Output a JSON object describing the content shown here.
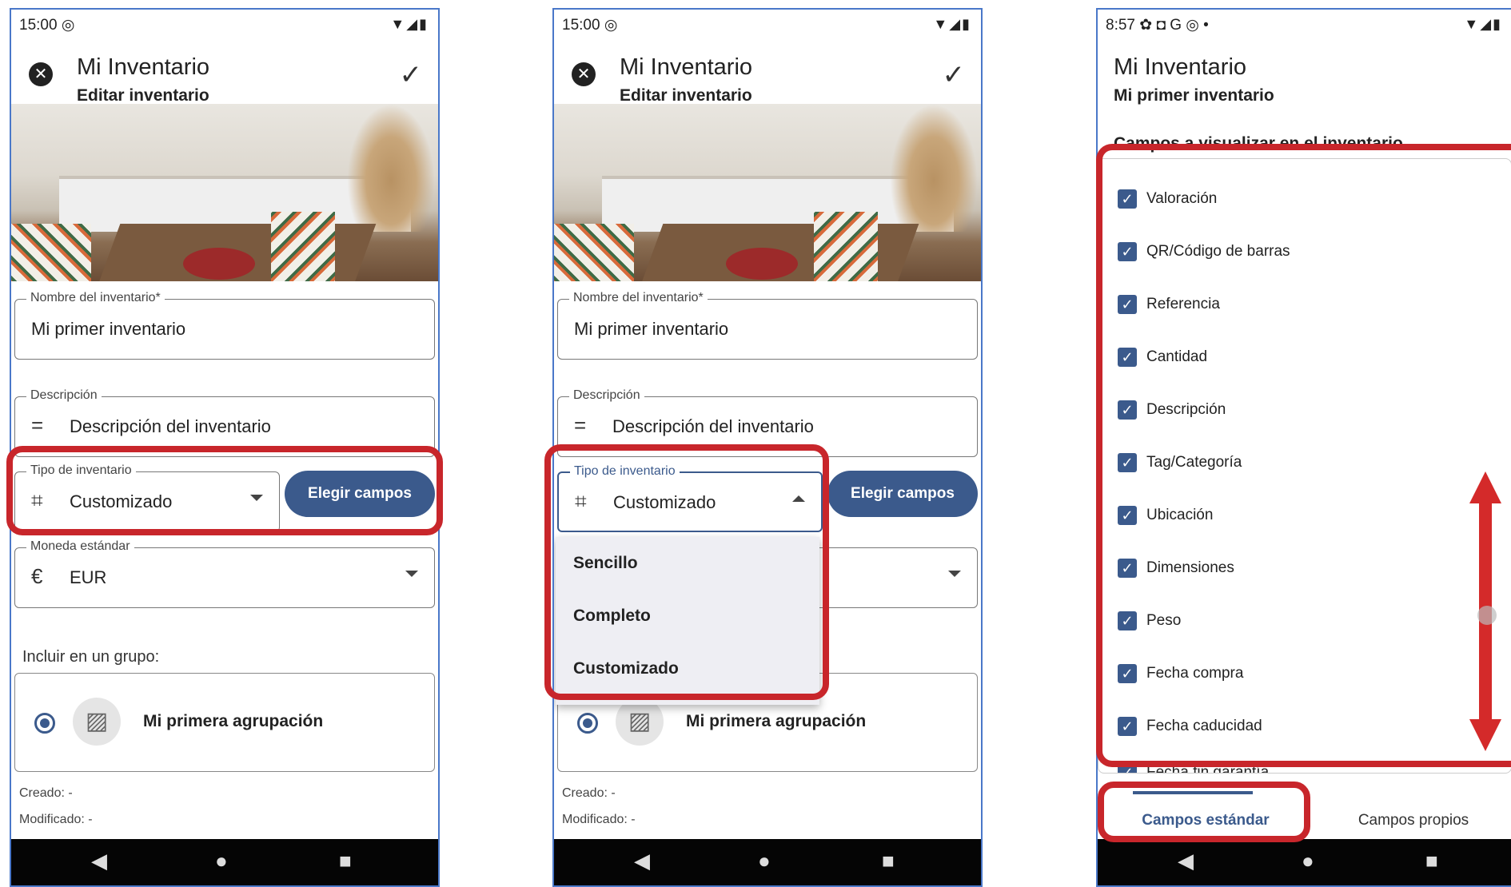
{
  "phone1": {
    "status_time": "15:00",
    "status_right": "▼◢▮",
    "title": "Mi Inventario",
    "subtitle": "Editar inventario",
    "name_label": "Nombre del inventario*",
    "name_value": "Mi primer inventario",
    "desc_label": "Descripción",
    "desc_value": "Descripción del inventario",
    "type_label": "Tipo de inventario",
    "type_value": "Customizado",
    "choose_button": "Elegir campos",
    "currency_label": "Moneda estándar",
    "currency_value": "EUR",
    "group_label": "Incluir en un grupo:",
    "group_name": "Mi primera agrupación",
    "created": "Creado: -",
    "modified": "Modificado: -"
  },
  "phone2": {
    "status_time": "15:00",
    "status_right": "▼◢▮",
    "title": "Mi Inventario",
    "subtitle": "Editar inventario",
    "name_label": "Nombre del inventario*",
    "name_value": "Mi primer inventario",
    "desc_label": "Descripción",
    "desc_value": "Descripción del inventario",
    "type_label": "Tipo de inventario",
    "type_value": "Customizado",
    "choose_button": "Elegir campos",
    "menu": [
      "Sencillo",
      "Completo",
      "Customizado"
    ],
    "group_name": "Mi primera agrupación",
    "created": "Creado: -",
    "modified": "Modificado: -"
  },
  "phone3": {
    "status_time": "8:57",
    "status_icons": "✿ ◘ G ◎ •",
    "status_right": "▼◢▮",
    "title": "Mi Inventario",
    "subtitle": "Mi primer inventario",
    "heading": "Campos a visualizar en el inventario.",
    "fields": [
      "Valoración",
      "QR/Código de barras",
      "Referencia",
      "Cantidad",
      "Descripción",
      "Tag/Categoría",
      "Ubicación",
      "Dimensiones",
      "Peso",
      "Fecha compra",
      "Fecha caducidad",
      "Fecha fin garantía"
    ],
    "tab_standard": "Campos estándar",
    "tab_own": "Campos propios"
  },
  "colors": {
    "primary": "#3b5a8c",
    "highlight": "#c8262b",
    "arrow": "#d42a2a"
  }
}
